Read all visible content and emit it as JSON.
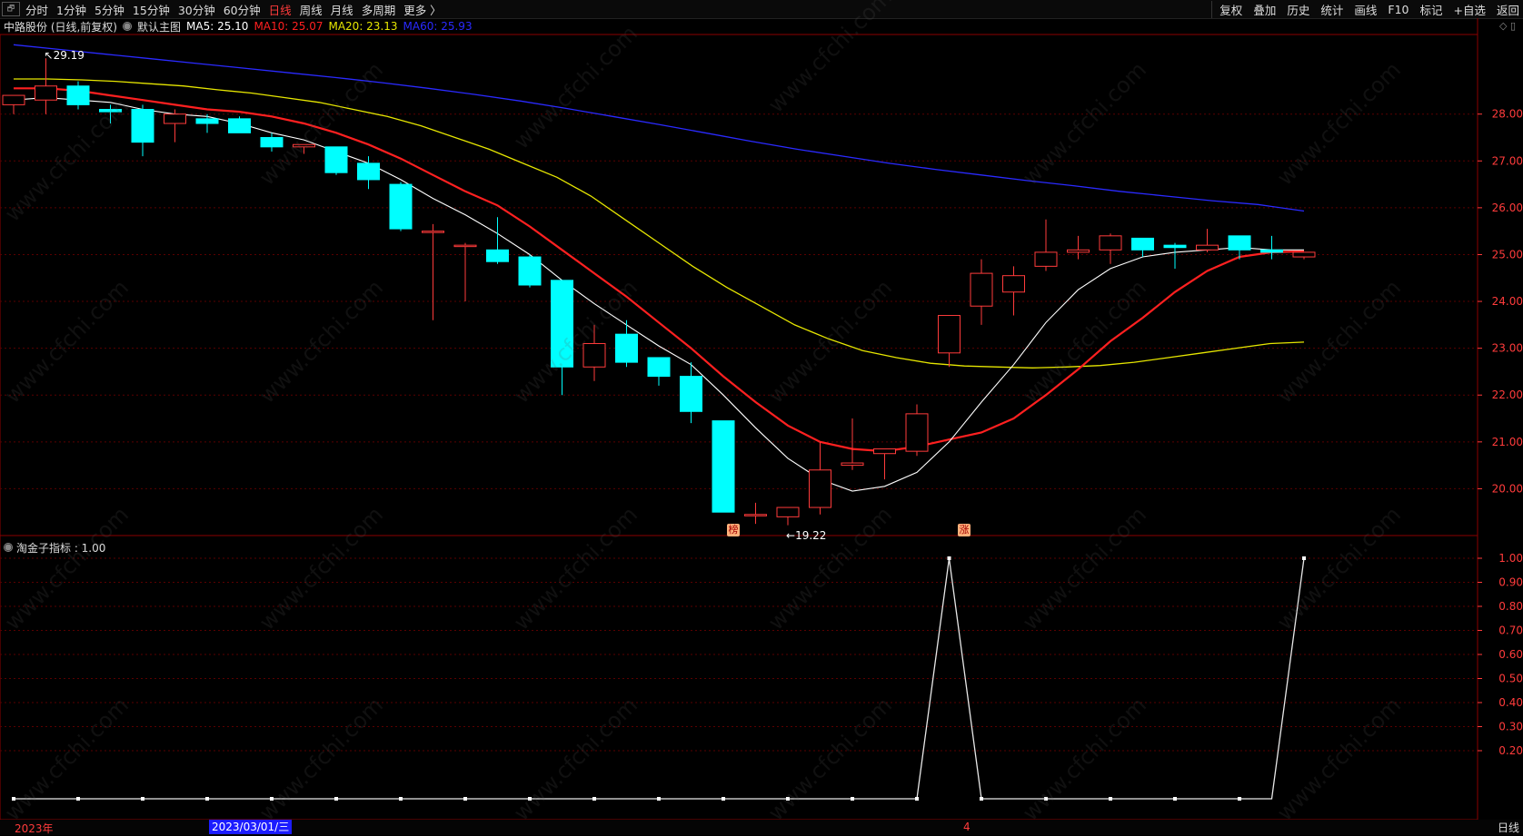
{
  "toolbar": {
    "corner_icon": "🗗",
    "periods": [
      "分时",
      "1分钟",
      "5分钟",
      "15分钟",
      "30分钟",
      "60分钟",
      "日线",
      "周线",
      "月线",
      "多周期",
      "更多 〉"
    ],
    "active_period": "日线",
    "right_tools": [
      "复权",
      "叠加",
      "历史",
      "统计",
      "画线",
      "F10",
      "标记",
      "+自选",
      "返回"
    ]
  },
  "main_info": {
    "stock": "中路股份 (日线,前复权)",
    "template": "默认主图",
    "ma5": "MA5: 25.10",
    "ma10": "MA10: 25.07",
    "ma20": "MA20: 23.13",
    "ma60": "MA60: 25.93"
  },
  "top_icons": "◇ ▯",
  "indicator": {
    "label": "淘金子指标 : 1.00"
  },
  "high_label": "29.19",
  "low_label": "19.22",
  "badges": {
    "b1": "榜",
    "b2": "涨"
  },
  "dates": {
    "start": "2023年",
    "selected": "2023/03/01/三",
    "mark": "4"
  },
  "corner_btn": "日线",
  "watermark_text": "www.cfchi.com",
  "colors": {
    "up": "#ff3b3b",
    "down": "#00ffff",
    "ma5": "#ffffff",
    "ma10": "#ff2020",
    "ma20": "#e6e600",
    "ma60": "#2a2aff",
    "axis": "#ff3b3b"
  },
  "chart_data": [
    {
      "type": "candlestick",
      "title": "中路股份 (日线,前复权)",
      "ylim": [
        19.0,
        29.7
      ],
      "y_ticks": [
        20.0,
        21.0,
        22.0,
        23.0,
        24.0,
        25.0,
        26.0,
        27.0,
        28.0
      ],
      "candles": [
        {
          "o": 28.2,
          "h": 28.4,
          "l": 28.0,
          "c": 28.4
        },
        {
          "o": 28.3,
          "h": 29.19,
          "l": 28.0,
          "c": 28.6
        },
        {
          "o": 28.6,
          "h": 28.7,
          "l": 28.1,
          "c": 28.2
        },
        {
          "o": 28.1,
          "h": 28.2,
          "l": 27.8,
          "c": 28.05
        },
        {
          "o": 28.1,
          "h": 28.2,
          "l": 27.1,
          "c": 27.4
        },
        {
          "o": 27.8,
          "h": 28.1,
          "l": 27.4,
          "c": 28.0
        },
        {
          "o": 27.9,
          "h": 28.0,
          "l": 27.6,
          "c": 27.8
        },
        {
          "o": 27.9,
          "h": 27.95,
          "l": 27.6,
          "c": 27.6
        },
        {
          "o": 27.5,
          "h": 27.6,
          "l": 27.2,
          "c": 27.3
        },
        {
          "o": 27.3,
          "h": 27.35,
          "l": 27.15,
          "c": 27.35
        },
        {
          "o": 27.3,
          "h": 27.3,
          "l": 26.7,
          "c": 26.75
        },
        {
          "o": 26.95,
          "h": 27.1,
          "l": 26.4,
          "c": 26.6
        },
        {
          "o": 26.5,
          "h": 26.55,
          "l": 25.5,
          "c": 25.55
        },
        {
          "o": 25.5,
          "h": 25.65,
          "l": 23.6,
          "c": 25.5
        },
        {
          "o": 25.2,
          "h": 25.25,
          "l": 24.0,
          "c": 25.2
        },
        {
          "o": 25.1,
          "h": 25.8,
          "l": 24.8,
          "c": 24.85
        },
        {
          "o": 24.95,
          "h": 25.0,
          "l": 24.3,
          "c": 24.35
        },
        {
          "o": 24.45,
          "h": 24.45,
          "l": 22.0,
          "c": 22.6
        },
        {
          "o": 22.6,
          "h": 23.5,
          "l": 22.3,
          "c": 23.1
        },
        {
          "o": 23.3,
          "h": 23.6,
          "l": 22.6,
          "c": 22.7
        },
        {
          "o": 22.8,
          "h": 22.8,
          "l": 22.2,
          "c": 22.4
        },
        {
          "o": 22.4,
          "h": 22.7,
          "l": 21.4,
          "c": 21.65
        },
        {
          "o": 21.45,
          "h": 21.45,
          "l": 19.5,
          "c": 19.5
        },
        {
          "o": 19.45,
          "h": 19.7,
          "l": 19.25,
          "c": 19.45
        },
        {
          "o": 19.4,
          "h": 19.6,
          "l": 19.22,
          "c": 19.6
        },
        {
          "o": 19.6,
          "h": 21.0,
          "l": 19.45,
          "c": 20.4
        },
        {
          "o": 20.5,
          "h": 21.5,
          "l": 20.4,
          "c": 20.55
        },
        {
          "o": 20.75,
          "h": 20.85,
          "l": 20.2,
          "c": 20.85
        },
        {
          "o": 20.8,
          "h": 21.8,
          "l": 20.7,
          "c": 21.6
        },
        {
          "o": 22.9,
          "h": 23.7,
          "l": 22.6,
          "c": 23.7
        },
        {
          "o": 23.9,
          "h": 24.9,
          "l": 23.5,
          "c": 24.6
        },
        {
          "o": 24.2,
          "h": 24.75,
          "l": 23.7,
          "c": 24.55
        },
        {
          "o": 24.75,
          "h": 25.75,
          "l": 24.65,
          "c": 25.05
        },
        {
          "o": 25.05,
          "h": 25.4,
          "l": 24.9,
          "c": 25.1
        },
        {
          "o": 25.1,
          "h": 25.45,
          "l": 24.8,
          "c": 25.4
        },
        {
          "o": 25.35,
          "h": 25.35,
          "l": 24.95,
          "c": 25.1
        },
        {
          "o": 25.2,
          "h": 25.25,
          "l": 24.7,
          "c": 25.15
        },
        {
          "o": 25.1,
          "h": 25.55,
          "l": 25.05,
          "c": 25.2
        },
        {
          "o": 25.4,
          "h": 25.4,
          "l": 24.9,
          "c": 25.1
        },
        {
          "o": 25.1,
          "h": 25.4,
          "l": 24.9,
          "c": 25.05
        },
        {
          "o": 24.95,
          "h": 25.05,
          "l": 24.9,
          "c": 25.05
        }
      ],
      "ma5": [
        28.3,
        28.35,
        28.3,
        28.25,
        28.1,
        28.0,
        27.95,
        27.8,
        27.6,
        27.45,
        27.2,
        26.95,
        26.6,
        26.2,
        25.85,
        25.45,
        25.0,
        24.45,
        23.95,
        23.5,
        23.05,
        22.65,
        22.0,
        21.3,
        20.65,
        20.2,
        19.95,
        20.05,
        20.35,
        21.0,
        21.85,
        22.65,
        23.55,
        24.25,
        24.7,
        24.95,
        25.05,
        25.1,
        25.15,
        25.1,
        25.1
      ],
      "ma10": [
        28.55,
        28.55,
        28.5,
        28.4,
        28.3,
        28.2,
        28.1,
        28.05,
        27.95,
        27.8,
        27.6,
        27.35,
        27.05,
        26.7,
        26.35,
        26.05,
        25.6,
        25.1,
        24.6,
        24.1,
        23.55,
        23.0,
        22.4,
        21.85,
        21.35,
        21.0,
        20.85,
        20.8,
        20.9,
        21.05,
        21.2,
        21.5,
        22.0,
        22.55,
        23.15,
        23.65,
        24.2,
        24.65,
        24.95,
        25.05,
        25.07
      ],
      "ma20": [
        28.75,
        28.75,
        28.73,
        28.7,
        28.65,
        28.6,
        28.52,
        28.45,
        28.35,
        28.25,
        28.1,
        27.95,
        27.75,
        27.5,
        27.25,
        26.95,
        26.65,
        26.25,
        25.75,
        25.25,
        24.75,
        24.3,
        23.9,
        23.5,
        23.2,
        22.95,
        22.8,
        22.68,
        22.62,
        22.6,
        22.58,
        22.6,
        22.63,
        22.7,
        22.8,
        22.9,
        23.0,
        23.1,
        23.13
      ],
      "ma60": [
        29.48,
        29.38,
        29.28,
        29.18,
        29.08,
        28.98,
        28.88,
        28.78,
        28.67,
        28.55,
        28.42,
        28.28,
        28.12,
        27.95,
        27.78,
        27.6,
        27.42,
        27.25,
        27.1,
        26.95,
        26.82,
        26.7,
        26.58,
        26.47,
        26.35,
        26.25,
        26.15,
        26.07,
        25.93
      ]
    },
    {
      "type": "line",
      "title": "淘金子指标",
      "ylim": [
        0,
        1.05
      ],
      "y_ticks": [
        0.2,
        0.3,
        0.4,
        0.5,
        0.6,
        0.7,
        0.8,
        0.9,
        1.0
      ],
      "values": [
        0,
        0,
        0,
        0,
        0,
        0,
        0,
        0,
        0,
        0,
        0,
        0,
        0,
        0,
        0,
        0,
        0,
        0,
        0,
        0,
        0,
        0,
        0,
        0,
        0,
        0,
        0,
        0,
        0,
        1,
        0,
        0,
        0,
        0,
        0,
        0,
        0,
        0,
        0,
        0,
        1
      ]
    }
  ]
}
